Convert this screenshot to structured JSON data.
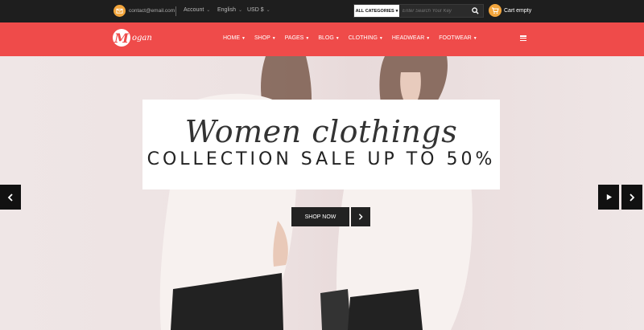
{
  "topbar": {
    "email": "contact@email.com",
    "account_label": "Account",
    "language_label": "English",
    "currency_label": "USD $",
    "search": {
      "category_label": "ALL CATEGORIES",
      "placeholder": "Enter Search Your Key"
    },
    "cart_label": "Cart empty"
  },
  "nav": {
    "logo_initial": "M",
    "logo_rest": "ogan",
    "items": [
      {
        "label": "HOME"
      },
      {
        "label": "SHOP"
      },
      {
        "label": "PAGES"
      },
      {
        "label": "BLOG"
      },
      {
        "label": "CLOTHING"
      },
      {
        "label": "HEADWEAR"
      },
      {
        "label": "FOOTWEAR"
      }
    ]
  },
  "hero": {
    "title": "Women clothings",
    "subtitle": "COLLECTION SALE UP TO 50%",
    "cta_label": "SHOP NOW"
  },
  "colors": {
    "brand_red": "#ef4b4a",
    "accent_orange": "#f2a53c",
    "topbar_bg": "#1e1e1e"
  },
  "icons": [
    "mail-icon",
    "search-icon",
    "cart-icon",
    "menu-icon",
    "prev-arrow-icon",
    "play-icon",
    "next-arrow-icon"
  ]
}
